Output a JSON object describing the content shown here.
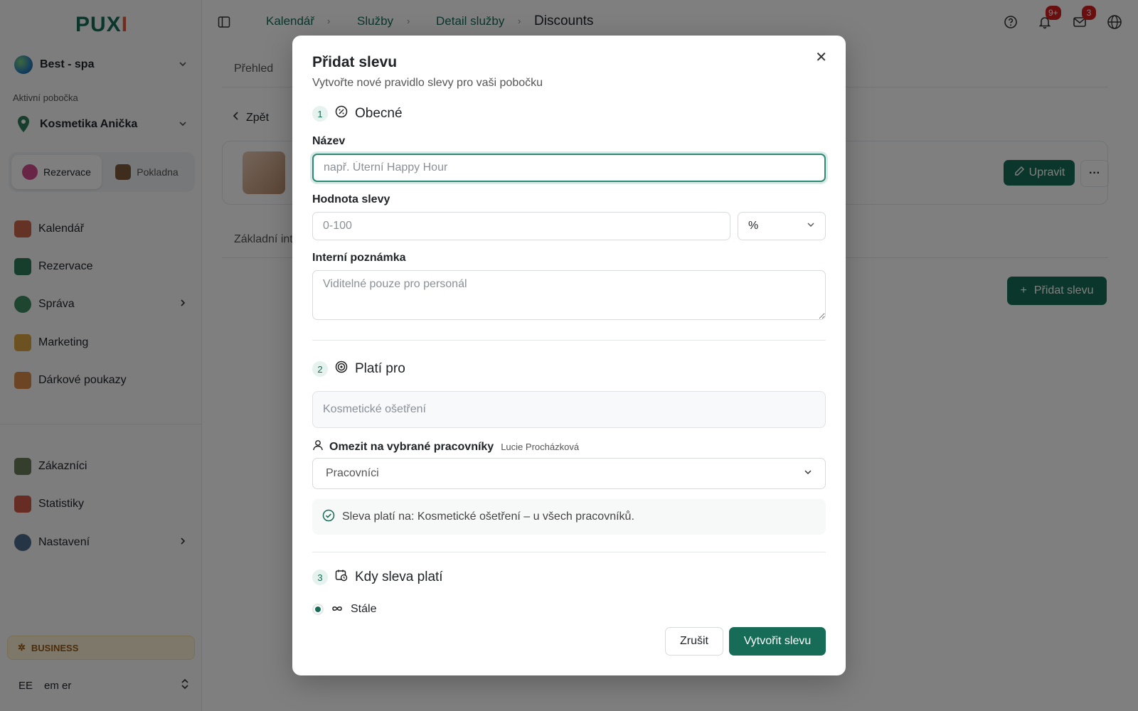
{
  "sidebar": {
    "logo_main": "PUX",
    "logo_accent": "I",
    "organization": "Best - spa",
    "branch_caption": "Aktivní pobočka",
    "branch": "Kosmetika Anička",
    "segments": [
      {
        "label": "Rezervace"
      },
      {
        "label": "Pokladna"
      }
    ],
    "nav_top": [
      {
        "label": "Kalendář",
        "color": "#c9674a"
      },
      {
        "label": "Rezervace",
        "color": "#2f7d5a"
      },
      {
        "label": "Správa",
        "color": "#3a8a5f"
      },
      {
        "label": "Marketing",
        "color": "#d9a441"
      },
      {
        "label": "Dárkové poukazy",
        "color": "#d98b4a"
      }
    ],
    "nav_bottom": [
      {
        "label": "Zákazníci",
        "color": "#6b7c5a"
      },
      {
        "label": "Statistiky",
        "color": "#cf5a4a"
      },
      {
        "label": "Nastavení",
        "color": "#4a6b8a"
      }
    ],
    "plan_badge": "BUSINESS",
    "user_initials": "EE",
    "user_name": "em er"
  },
  "topbar": {
    "breadcrumbs": [
      "Kalendář",
      "Služby",
      "Detail služby"
    ],
    "current": "Discounts",
    "notifications_count": "9+",
    "messages_count": "3"
  },
  "page": {
    "tab_overview": "Přehled",
    "back_label": "Zpět",
    "edit_label": "Upravit",
    "more_label": "···",
    "tab_basic": "Základní int",
    "add_discount_label": "Přidat slevu"
  },
  "modal": {
    "title": "Přidat slevu",
    "subtitle": "Vytvořte nové pravidlo slevy pro vaši pobočku",
    "close": "✕",
    "step1": {
      "num": "1",
      "title": "Obecné"
    },
    "name_label": "Název",
    "name_placeholder": "např. Úterní Happy Hour",
    "value_label": "Hodnota slevy",
    "value_placeholder": "0-100",
    "unit_value": "%",
    "note_label": "Interní poznámka",
    "note_placeholder": "Viditelné pouze pro personál",
    "step2": {
      "num": "2",
      "title": "Platí pro"
    },
    "service_value": "Kosmetické ošetření",
    "restrict_label": "Omezit na vybrané pracovníky",
    "restrict_name": "Lucie Procházková",
    "workers_value": "Pracovníci",
    "info_text": "Sleva platí na: Kosmetické ošetření – u všech pracovníků.",
    "step3": {
      "num": "3",
      "title": "Kdy sleva platí"
    },
    "always_label": "Stále",
    "cancel_label": "Zrušit",
    "create_label": "Vytvořit slevu"
  },
  "colors": {
    "brand": "#176c57",
    "badge_red": "#d21f1f"
  }
}
